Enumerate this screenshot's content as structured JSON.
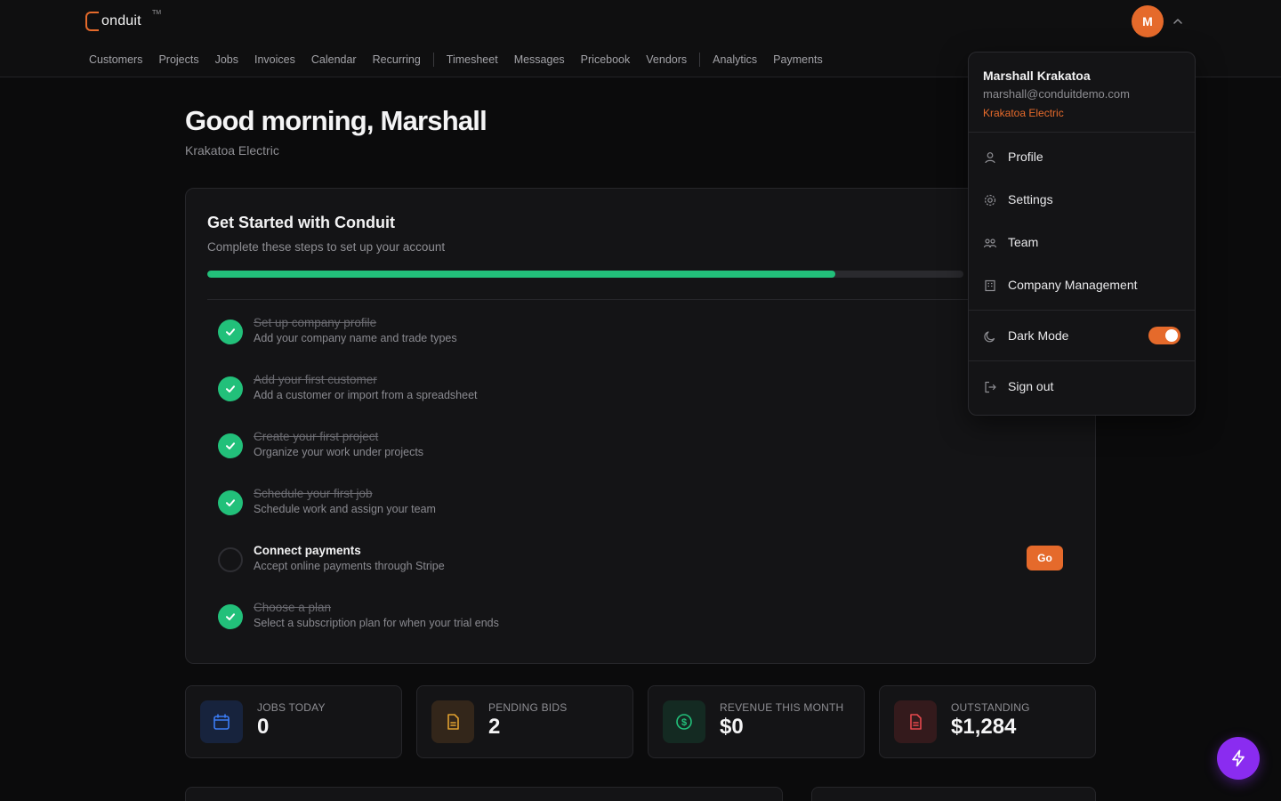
{
  "app": {
    "logo_text": "onduit",
    "logo_tm": "TM",
    "avatar_initial": "M"
  },
  "nav": [
    "Customers",
    "Projects",
    "Jobs",
    "Invoices",
    "Calendar",
    "Recurring",
    "Timesheet",
    "Messages",
    "Pricebook",
    "Vendors",
    "Analytics",
    "Payments"
  ],
  "header": {
    "greeting": "Good morning, Marshall",
    "company": "Krakatoa Electric"
  },
  "onboarding": {
    "title": "Get Started with Conduit",
    "subtitle": "Complete these steps to set up your account",
    "progress": 0.83,
    "steps": [
      {
        "title": "Set up company profile",
        "desc": "Add your company name and trade types",
        "done": true
      },
      {
        "title": "Add your first customer",
        "desc": "Add a customer or import from a spreadsheet",
        "done": true
      },
      {
        "title": "Create your first project",
        "desc": "Organize your work under projects",
        "done": true
      },
      {
        "title": "Schedule your first job",
        "desc": "Schedule work and assign your team",
        "done": true
      },
      {
        "title": "Connect payments",
        "desc": "Accept online payments through Stripe",
        "done": false
      },
      {
        "title": "Choose a plan",
        "desc": "Select a subscription plan for when your trial ends",
        "done": true
      }
    ],
    "go_label": "Go"
  },
  "stats": [
    {
      "label": "JOBS TODAY",
      "value": "0",
      "icon": "calendar-icon",
      "color": "#3b7cf5"
    },
    {
      "label": "PENDING BIDS",
      "value": "2",
      "icon": "document-icon",
      "color": "#e0a030"
    },
    {
      "label": "REVENUE THIS MONTH",
      "value": "$0",
      "icon": "dollar-icon",
      "color": "#22c07a"
    },
    {
      "label": "OUTSTANDING",
      "value": "$1,284",
      "icon": "invoice-icon",
      "color": "#e5484d"
    }
  ],
  "user_menu": {
    "name": "Marshall Krakatoa",
    "email": "marshall@conduitdemo.com",
    "company": "Krakatoa Electric",
    "items": {
      "profile": "Profile",
      "settings": "Settings",
      "team": "Team",
      "company_management": "Company Management",
      "dark_mode": "Dark Mode",
      "sign_out": "Sign out"
    },
    "dark_mode_on": true
  },
  "colors": {
    "accent": "#e56a2b",
    "success": "#22c07a",
    "fab": "#8a2cf0"
  }
}
